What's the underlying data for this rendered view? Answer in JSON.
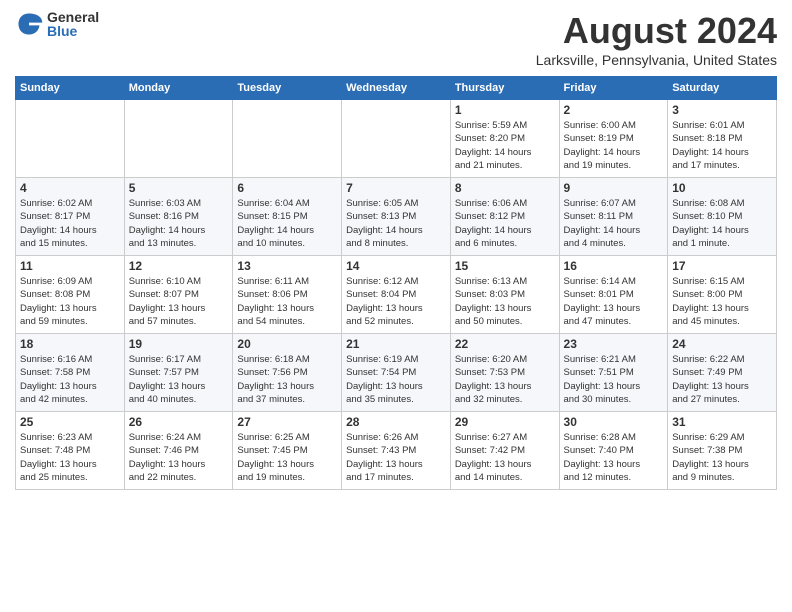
{
  "logo": {
    "general": "General",
    "blue": "Blue"
  },
  "header": {
    "month_year": "August 2024",
    "location": "Larksville, Pennsylvania, United States"
  },
  "weekdays": [
    "Sunday",
    "Monday",
    "Tuesday",
    "Wednesday",
    "Thursday",
    "Friday",
    "Saturday"
  ],
  "weeks": [
    [
      {
        "day": "",
        "info": ""
      },
      {
        "day": "",
        "info": ""
      },
      {
        "day": "",
        "info": ""
      },
      {
        "day": "",
        "info": ""
      },
      {
        "day": "1",
        "info": "Sunrise: 5:59 AM\nSunset: 8:20 PM\nDaylight: 14 hours\nand 21 minutes."
      },
      {
        "day": "2",
        "info": "Sunrise: 6:00 AM\nSunset: 8:19 PM\nDaylight: 14 hours\nand 19 minutes."
      },
      {
        "day": "3",
        "info": "Sunrise: 6:01 AM\nSunset: 8:18 PM\nDaylight: 14 hours\nand 17 minutes."
      }
    ],
    [
      {
        "day": "4",
        "info": "Sunrise: 6:02 AM\nSunset: 8:17 PM\nDaylight: 14 hours\nand 15 minutes."
      },
      {
        "day": "5",
        "info": "Sunrise: 6:03 AM\nSunset: 8:16 PM\nDaylight: 14 hours\nand 13 minutes."
      },
      {
        "day": "6",
        "info": "Sunrise: 6:04 AM\nSunset: 8:15 PM\nDaylight: 14 hours\nand 10 minutes."
      },
      {
        "day": "7",
        "info": "Sunrise: 6:05 AM\nSunset: 8:13 PM\nDaylight: 14 hours\nand 8 minutes."
      },
      {
        "day": "8",
        "info": "Sunrise: 6:06 AM\nSunset: 8:12 PM\nDaylight: 14 hours\nand 6 minutes."
      },
      {
        "day": "9",
        "info": "Sunrise: 6:07 AM\nSunset: 8:11 PM\nDaylight: 14 hours\nand 4 minutes."
      },
      {
        "day": "10",
        "info": "Sunrise: 6:08 AM\nSunset: 8:10 PM\nDaylight: 14 hours\nand 1 minute."
      }
    ],
    [
      {
        "day": "11",
        "info": "Sunrise: 6:09 AM\nSunset: 8:08 PM\nDaylight: 13 hours\nand 59 minutes."
      },
      {
        "day": "12",
        "info": "Sunrise: 6:10 AM\nSunset: 8:07 PM\nDaylight: 13 hours\nand 57 minutes."
      },
      {
        "day": "13",
        "info": "Sunrise: 6:11 AM\nSunset: 8:06 PM\nDaylight: 13 hours\nand 54 minutes."
      },
      {
        "day": "14",
        "info": "Sunrise: 6:12 AM\nSunset: 8:04 PM\nDaylight: 13 hours\nand 52 minutes."
      },
      {
        "day": "15",
        "info": "Sunrise: 6:13 AM\nSunset: 8:03 PM\nDaylight: 13 hours\nand 50 minutes."
      },
      {
        "day": "16",
        "info": "Sunrise: 6:14 AM\nSunset: 8:01 PM\nDaylight: 13 hours\nand 47 minutes."
      },
      {
        "day": "17",
        "info": "Sunrise: 6:15 AM\nSunset: 8:00 PM\nDaylight: 13 hours\nand 45 minutes."
      }
    ],
    [
      {
        "day": "18",
        "info": "Sunrise: 6:16 AM\nSunset: 7:58 PM\nDaylight: 13 hours\nand 42 minutes."
      },
      {
        "day": "19",
        "info": "Sunrise: 6:17 AM\nSunset: 7:57 PM\nDaylight: 13 hours\nand 40 minutes."
      },
      {
        "day": "20",
        "info": "Sunrise: 6:18 AM\nSunset: 7:56 PM\nDaylight: 13 hours\nand 37 minutes."
      },
      {
        "day": "21",
        "info": "Sunrise: 6:19 AM\nSunset: 7:54 PM\nDaylight: 13 hours\nand 35 minutes."
      },
      {
        "day": "22",
        "info": "Sunrise: 6:20 AM\nSunset: 7:53 PM\nDaylight: 13 hours\nand 32 minutes."
      },
      {
        "day": "23",
        "info": "Sunrise: 6:21 AM\nSunset: 7:51 PM\nDaylight: 13 hours\nand 30 minutes."
      },
      {
        "day": "24",
        "info": "Sunrise: 6:22 AM\nSunset: 7:49 PM\nDaylight: 13 hours\nand 27 minutes."
      }
    ],
    [
      {
        "day": "25",
        "info": "Sunrise: 6:23 AM\nSunset: 7:48 PM\nDaylight: 13 hours\nand 25 minutes."
      },
      {
        "day": "26",
        "info": "Sunrise: 6:24 AM\nSunset: 7:46 PM\nDaylight: 13 hours\nand 22 minutes."
      },
      {
        "day": "27",
        "info": "Sunrise: 6:25 AM\nSunset: 7:45 PM\nDaylight: 13 hours\nand 19 minutes."
      },
      {
        "day": "28",
        "info": "Sunrise: 6:26 AM\nSunset: 7:43 PM\nDaylight: 13 hours\nand 17 minutes."
      },
      {
        "day": "29",
        "info": "Sunrise: 6:27 AM\nSunset: 7:42 PM\nDaylight: 13 hours\nand 14 minutes."
      },
      {
        "day": "30",
        "info": "Sunrise: 6:28 AM\nSunset: 7:40 PM\nDaylight: 13 hours\nand 12 minutes."
      },
      {
        "day": "31",
        "info": "Sunrise: 6:29 AM\nSunset: 7:38 PM\nDaylight: 13 hours\nand 9 minutes."
      }
    ]
  ]
}
